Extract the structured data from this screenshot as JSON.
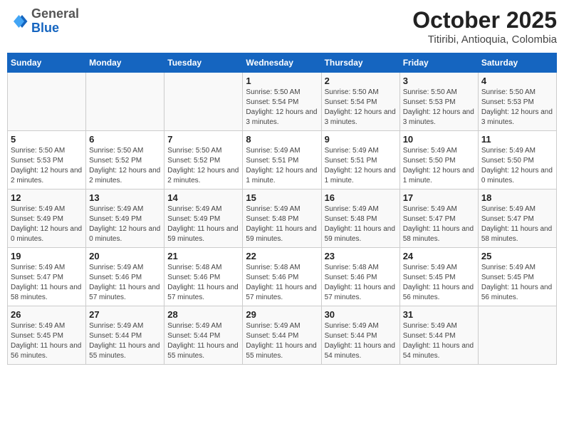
{
  "header": {
    "logo_general": "General",
    "logo_blue": "Blue",
    "month_year": "October 2025",
    "location": "Titiribi, Antioquia, Colombia"
  },
  "days_of_week": [
    "Sunday",
    "Monday",
    "Tuesday",
    "Wednesday",
    "Thursday",
    "Friday",
    "Saturday"
  ],
  "weeks": [
    [
      {
        "day": "",
        "sunrise": "",
        "sunset": "",
        "daylight": ""
      },
      {
        "day": "",
        "sunrise": "",
        "sunset": "",
        "daylight": ""
      },
      {
        "day": "",
        "sunrise": "",
        "sunset": "",
        "daylight": ""
      },
      {
        "day": "1",
        "sunrise": "Sunrise: 5:50 AM",
        "sunset": "Sunset: 5:54 PM",
        "daylight": "Daylight: 12 hours and 3 minutes."
      },
      {
        "day": "2",
        "sunrise": "Sunrise: 5:50 AM",
        "sunset": "Sunset: 5:54 PM",
        "daylight": "Daylight: 12 hours and 3 minutes."
      },
      {
        "day": "3",
        "sunrise": "Sunrise: 5:50 AM",
        "sunset": "Sunset: 5:53 PM",
        "daylight": "Daylight: 12 hours and 3 minutes."
      },
      {
        "day": "4",
        "sunrise": "Sunrise: 5:50 AM",
        "sunset": "Sunset: 5:53 PM",
        "daylight": "Daylight: 12 hours and 3 minutes."
      }
    ],
    [
      {
        "day": "5",
        "sunrise": "Sunrise: 5:50 AM",
        "sunset": "Sunset: 5:53 PM",
        "daylight": "Daylight: 12 hours and 2 minutes."
      },
      {
        "day": "6",
        "sunrise": "Sunrise: 5:50 AM",
        "sunset": "Sunset: 5:52 PM",
        "daylight": "Daylight: 12 hours and 2 minutes."
      },
      {
        "day": "7",
        "sunrise": "Sunrise: 5:50 AM",
        "sunset": "Sunset: 5:52 PM",
        "daylight": "Daylight: 12 hours and 2 minutes."
      },
      {
        "day": "8",
        "sunrise": "Sunrise: 5:49 AM",
        "sunset": "Sunset: 5:51 PM",
        "daylight": "Daylight: 12 hours and 1 minute."
      },
      {
        "day": "9",
        "sunrise": "Sunrise: 5:49 AM",
        "sunset": "Sunset: 5:51 PM",
        "daylight": "Daylight: 12 hours and 1 minute."
      },
      {
        "day": "10",
        "sunrise": "Sunrise: 5:49 AM",
        "sunset": "Sunset: 5:50 PM",
        "daylight": "Daylight: 12 hours and 1 minute."
      },
      {
        "day": "11",
        "sunrise": "Sunrise: 5:49 AM",
        "sunset": "Sunset: 5:50 PM",
        "daylight": "Daylight: 12 hours and 0 minutes."
      }
    ],
    [
      {
        "day": "12",
        "sunrise": "Sunrise: 5:49 AM",
        "sunset": "Sunset: 5:49 PM",
        "daylight": "Daylight: 12 hours and 0 minutes."
      },
      {
        "day": "13",
        "sunrise": "Sunrise: 5:49 AM",
        "sunset": "Sunset: 5:49 PM",
        "daylight": "Daylight: 12 hours and 0 minutes."
      },
      {
        "day": "14",
        "sunrise": "Sunrise: 5:49 AM",
        "sunset": "Sunset: 5:49 PM",
        "daylight": "Daylight: 11 hours and 59 minutes."
      },
      {
        "day": "15",
        "sunrise": "Sunrise: 5:49 AM",
        "sunset": "Sunset: 5:48 PM",
        "daylight": "Daylight: 11 hours and 59 minutes."
      },
      {
        "day": "16",
        "sunrise": "Sunrise: 5:49 AM",
        "sunset": "Sunset: 5:48 PM",
        "daylight": "Daylight: 11 hours and 59 minutes."
      },
      {
        "day": "17",
        "sunrise": "Sunrise: 5:49 AM",
        "sunset": "Sunset: 5:47 PM",
        "daylight": "Daylight: 11 hours and 58 minutes."
      },
      {
        "day": "18",
        "sunrise": "Sunrise: 5:49 AM",
        "sunset": "Sunset: 5:47 PM",
        "daylight": "Daylight: 11 hours and 58 minutes."
      }
    ],
    [
      {
        "day": "19",
        "sunrise": "Sunrise: 5:49 AM",
        "sunset": "Sunset: 5:47 PM",
        "daylight": "Daylight: 11 hours and 58 minutes."
      },
      {
        "day": "20",
        "sunrise": "Sunrise: 5:49 AM",
        "sunset": "Sunset: 5:46 PM",
        "daylight": "Daylight: 11 hours and 57 minutes."
      },
      {
        "day": "21",
        "sunrise": "Sunrise: 5:48 AM",
        "sunset": "Sunset: 5:46 PM",
        "daylight": "Daylight: 11 hours and 57 minutes."
      },
      {
        "day": "22",
        "sunrise": "Sunrise: 5:48 AM",
        "sunset": "Sunset: 5:46 PM",
        "daylight": "Daylight: 11 hours and 57 minutes."
      },
      {
        "day": "23",
        "sunrise": "Sunrise: 5:48 AM",
        "sunset": "Sunset: 5:46 PM",
        "daylight": "Daylight: 11 hours and 57 minutes."
      },
      {
        "day": "24",
        "sunrise": "Sunrise: 5:49 AM",
        "sunset": "Sunset: 5:45 PM",
        "daylight": "Daylight: 11 hours and 56 minutes."
      },
      {
        "day": "25",
        "sunrise": "Sunrise: 5:49 AM",
        "sunset": "Sunset: 5:45 PM",
        "daylight": "Daylight: 11 hours and 56 minutes."
      }
    ],
    [
      {
        "day": "26",
        "sunrise": "Sunrise: 5:49 AM",
        "sunset": "Sunset: 5:45 PM",
        "daylight": "Daylight: 11 hours and 56 minutes."
      },
      {
        "day": "27",
        "sunrise": "Sunrise: 5:49 AM",
        "sunset": "Sunset: 5:44 PM",
        "daylight": "Daylight: 11 hours and 55 minutes."
      },
      {
        "day": "28",
        "sunrise": "Sunrise: 5:49 AM",
        "sunset": "Sunset: 5:44 PM",
        "daylight": "Daylight: 11 hours and 55 minutes."
      },
      {
        "day": "29",
        "sunrise": "Sunrise: 5:49 AM",
        "sunset": "Sunset: 5:44 PM",
        "daylight": "Daylight: 11 hours and 55 minutes."
      },
      {
        "day": "30",
        "sunrise": "Sunrise: 5:49 AM",
        "sunset": "Sunset: 5:44 PM",
        "daylight": "Daylight: 11 hours and 54 minutes."
      },
      {
        "day": "31",
        "sunrise": "Sunrise: 5:49 AM",
        "sunset": "Sunset: 5:44 PM",
        "daylight": "Daylight: 11 hours and 54 minutes."
      },
      {
        "day": "",
        "sunrise": "",
        "sunset": "",
        "daylight": ""
      }
    ]
  ]
}
